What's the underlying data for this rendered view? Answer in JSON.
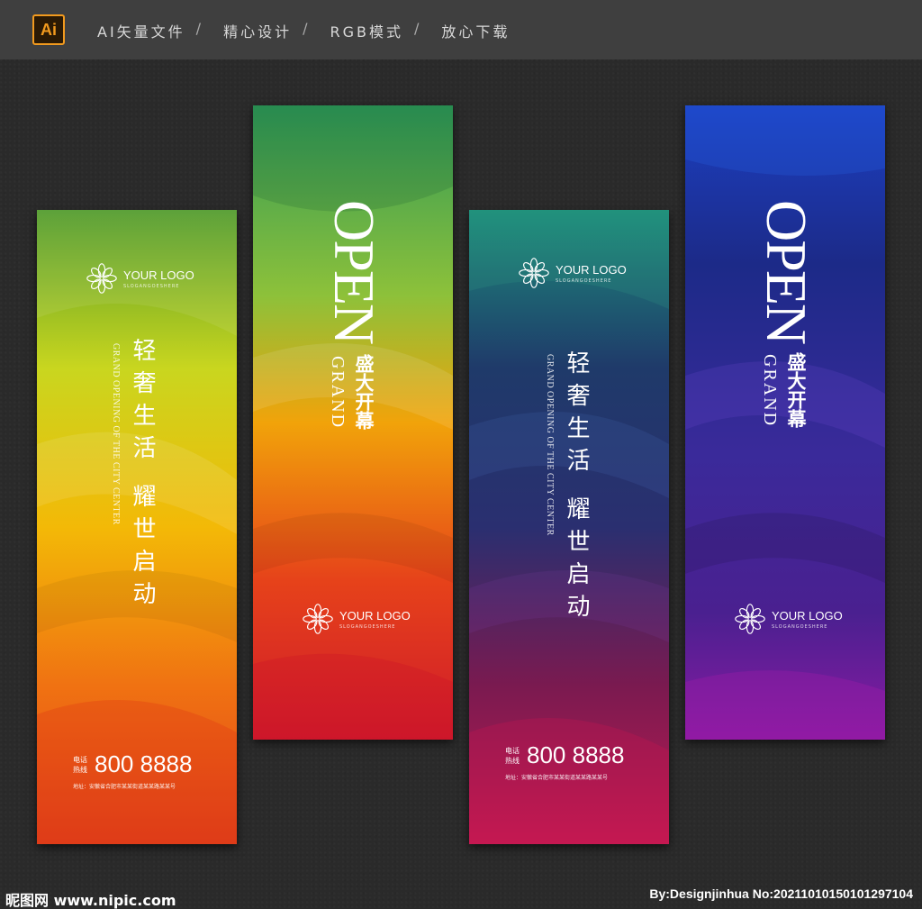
{
  "header": {
    "badge": "Ai",
    "items": [
      "AI矢量文件",
      "精心设计",
      "RGB模式",
      "放心下载"
    ],
    "separator": "/"
  },
  "banners": {
    "b1": {
      "logo_name": "YOUR LOGO",
      "logo_slogan": "SLOGANGOESHERE",
      "tagline": "轻奢生活 耀世启动",
      "eng": "GRAND OPENING OF THE CITY CENTER",
      "contact_label": "电话热线",
      "phone": "800 8888",
      "address": "地址：安徽省合肥市某某街道某某路某某号",
      "colors": [
        "#5aa02a",
        "#c8d51f",
        "#f2b806",
        "#f06a0c",
        "#e2401a"
      ]
    },
    "b2": {
      "open": "OPEN",
      "grand": "GRAND",
      "cn": "盛大开幕",
      "logo_name": "YOUR LOGO",
      "logo_slogan": "SLOGANGOESHERE",
      "colors": [
        "#2f9a57",
        "#8fc23c",
        "#f2a60a",
        "#e8401a",
        "#d01a2a"
      ]
    },
    "b3": {
      "logo_name": "YOUR LOGO",
      "logo_slogan": "SLOGANGOESHERE",
      "tagline": "轻奢生活 耀世启动",
      "eng": "GRAND OPENING OF THE CITY CENTER",
      "contact_label": "电话热线",
      "phone": "800 8888",
      "address": "地址：安徽省合肥市某某街道某某路某某号",
      "colors": [
        "#1f8a7a",
        "#243a6e",
        "#3a2a7a",
        "#8a1a4e",
        "#c01a50"
      ]
    },
    "b4": {
      "open": "OPEN",
      "grand": "GRAND",
      "cn": "盛大开幕",
      "logo_name": "YOUR LOGO",
      "logo_slogan": "SLOGANGOESHERE",
      "colors": [
        "#1a3fc0",
        "#1d2a8a",
        "#3a2a9a",
        "#4a2090",
        "#8a1aa0"
      ]
    }
  },
  "footer": {
    "left": "昵图网 www.nipic.com",
    "right": "By:Designjinhua No:20211010150101297104"
  }
}
